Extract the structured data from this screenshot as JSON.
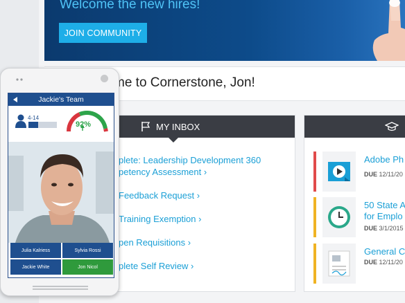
{
  "banner": {
    "title": "Welcome the new hires!",
    "button": "JOIN COMMUNITY"
  },
  "welcome": {
    "text": "me to Cornerstone, Jon!"
  },
  "inbox": {
    "header": "MY INBOX",
    "items": [
      "plete: Leadership Development 360",
      "petency Assessment ›",
      "Feedback Request ›",
      "Training Exemption ›",
      "pen Requisitions ›",
      "plete Self Review ›"
    ]
  },
  "training": {
    "courses": [
      {
        "title": "Adobe Ph",
        "due_label": "DUE",
        "due_date": "12/11/20",
        "color": "#e14b4b",
        "icon": "play-icon"
      },
      {
        "title": "50 State A",
        "title2": "for Emplo",
        "due_label": "DUE",
        "due_date": "3/1/2015",
        "color": "#f0b323",
        "icon": "clock-icon"
      },
      {
        "title": "General C",
        "due_label": "DUE",
        "due_date": "12/11/20",
        "color": "#f0b323",
        "icon": "document-icon"
      }
    ]
  },
  "phone": {
    "team_title": "Jackie's Team",
    "range": "4-14",
    "range_fill": 0.35,
    "gauge_value": "92%",
    "members": [
      "Julia Kalriess",
      "Sylvia Rossi",
      "Jackie White",
      "Jon Nicol"
    ]
  },
  "colors": {
    "brand_blue": "#1f4f8f",
    "accent": "#1a9fd6",
    "active_green": "#2f9a3c"
  }
}
